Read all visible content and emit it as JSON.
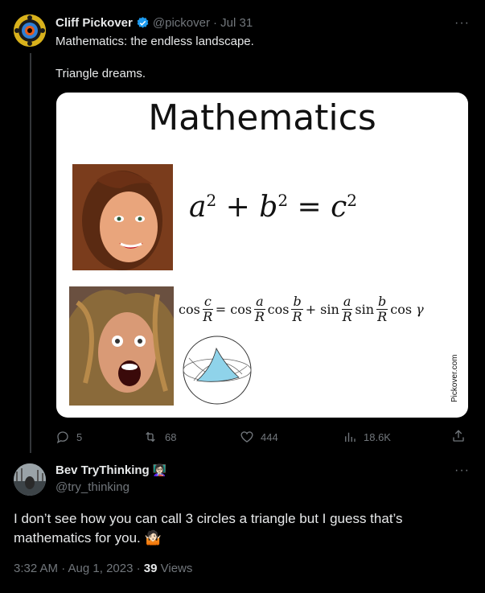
{
  "tweet": {
    "author_name": "Cliff Pickover",
    "handle": "@pickover",
    "date": "· Jul 31",
    "line1": "Mathematics: the endless landscape.",
    "line2": "Triangle dreams.",
    "more": "···",
    "image": {
      "title": "Mathematics",
      "watermark": "Pickover.com"
    },
    "actions": {
      "replies": "5",
      "retweets": "68",
      "likes": "444",
      "views": "18.6K"
    }
  },
  "reply": {
    "author_name": "Bev TryThinking",
    "author_emoji": "👩🏻‍🏫",
    "handle": "@try_thinking",
    "text": "I don’t see how you can call 3 circles a triangle but I guess that’s mathematics for you. 🤷🏻",
    "more": "···",
    "time": "3:32 AM · Aug 1, 2023 · ",
    "views_count": "39",
    "views_label": " Views"
  },
  "colors": {
    "background": "#000000",
    "text": "#e7e9ea",
    "muted": "#71767b",
    "verified": "#1d9bf0"
  }
}
